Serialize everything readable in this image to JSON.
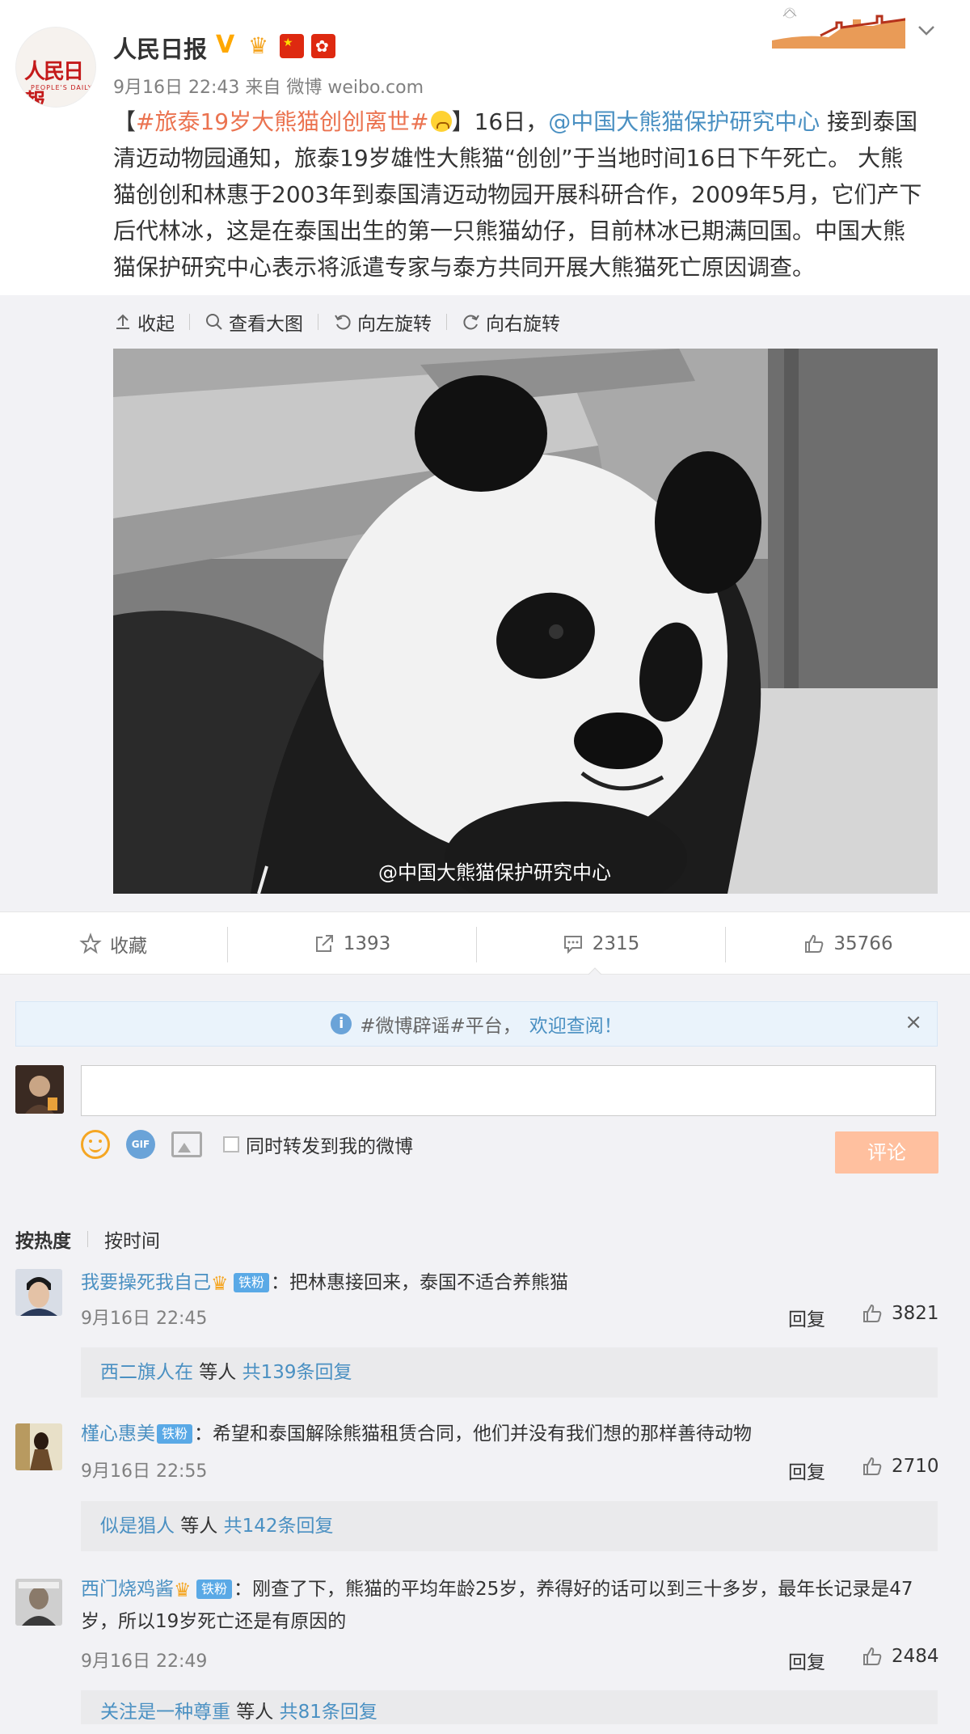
{
  "post": {
    "author": "人民日报",
    "avatar_text": "人民日報",
    "avatar_sub": "PEOPLE'S DAILY",
    "verified": "V",
    "badges": [
      "crown-badge-icon",
      "china-flag-icon",
      "hk-flag-icon"
    ],
    "meta": "9月16日 22:43 来自 微博 weibo.com",
    "text_prefix": "【",
    "hashtag": "#旅泰19岁大熊猫创创离世#",
    "text_after_hashtag": "】16日，",
    "mention": "@中国大熊猫保护研究中心",
    "body": " 接到泰国清迈动物园通知，旅泰19岁雄性大熊猫“创创”于当地时间16日下午死亡。 大熊猫创创和林惠于2003年到泰国清迈动物园开展科研合作，2009年5月，它们产下后代林冰，这是在泰国出生的第一只熊猫幼仔，目前林冰已期满回国。中国大熊猫保护研究中心表示将派遣专家与泰方共同开展大熊猫死亡原因调查。"
  },
  "media_toolbar": {
    "collapse": "收起",
    "view_large": "查看大图",
    "rotate_left": "向左旋转",
    "rotate_right": "向右旋转"
  },
  "image": {
    "watermark": "@中国大熊猫保护研究中心"
  },
  "actions": {
    "favorite": "收藏",
    "reposts": "1393",
    "comments": "2315",
    "likes": "35766"
  },
  "notice": {
    "tag": "#微博辟谣#平台，",
    "link": "欢迎查阅！",
    "close": "×"
  },
  "composer": {
    "placeholder": "",
    "sync_label": "同时转发到我的微博",
    "submit": "评论",
    "gif": "GIF"
  },
  "sort": {
    "hot": "按热度",
    "time": "按时间"
  },
  "comments": [
    {
      "user": "我要操死我自己",
      "crown": true,
      "fan": "铁粉",
      "text": "：把林惠接回来，泰国不适合养熊猫",
      "time": "9月16日 22:45",
      "reply": "回复",
      "likes": "3821",
      "sub_user": "西二旗人在",
      "sub_mid": " 等人 ",
      "sub_link": "共139条回复"
    },
    {
      "user": "槿心惠美",
      "crown": false,
      "fan": "铁粉",
      "text": "：希望和泰国解除熊猫租赁合同，他们并没有我们想的那样善待动物",
      "time": "9月16日 22:55",
      "reply": "回复",
      "likes": "2710",
      "sub_user": "似是猖人",
      "sub_mid": " 等人 ",
      "sub_link": "共142条回复"
    },
    {
      "user": "西门烧鸡酱",
      "crown": true,
      "fan": "铁粉",
      "text": "：刚查了下，熊猫的平均年龄25岁，养得好的话可以到三十多岁，最年长记录是47岁，所以19岁死亡还是有原因的",
      "time": "9月16日 22:49",
      "reply": "回复",
      "likes": "2484",
      "sub_user": "关注是一种尊重",
      "sub_mid": " 等人 ",
      "sub_link": "共81条回复"
    }
  ],
  "colors": {
    "link_orange": "#eb7350",
    "link_blue": "#4a90c2",
    "submit_bg": "#ffc09f",
    "verified": "#ffa800"
  }
}
